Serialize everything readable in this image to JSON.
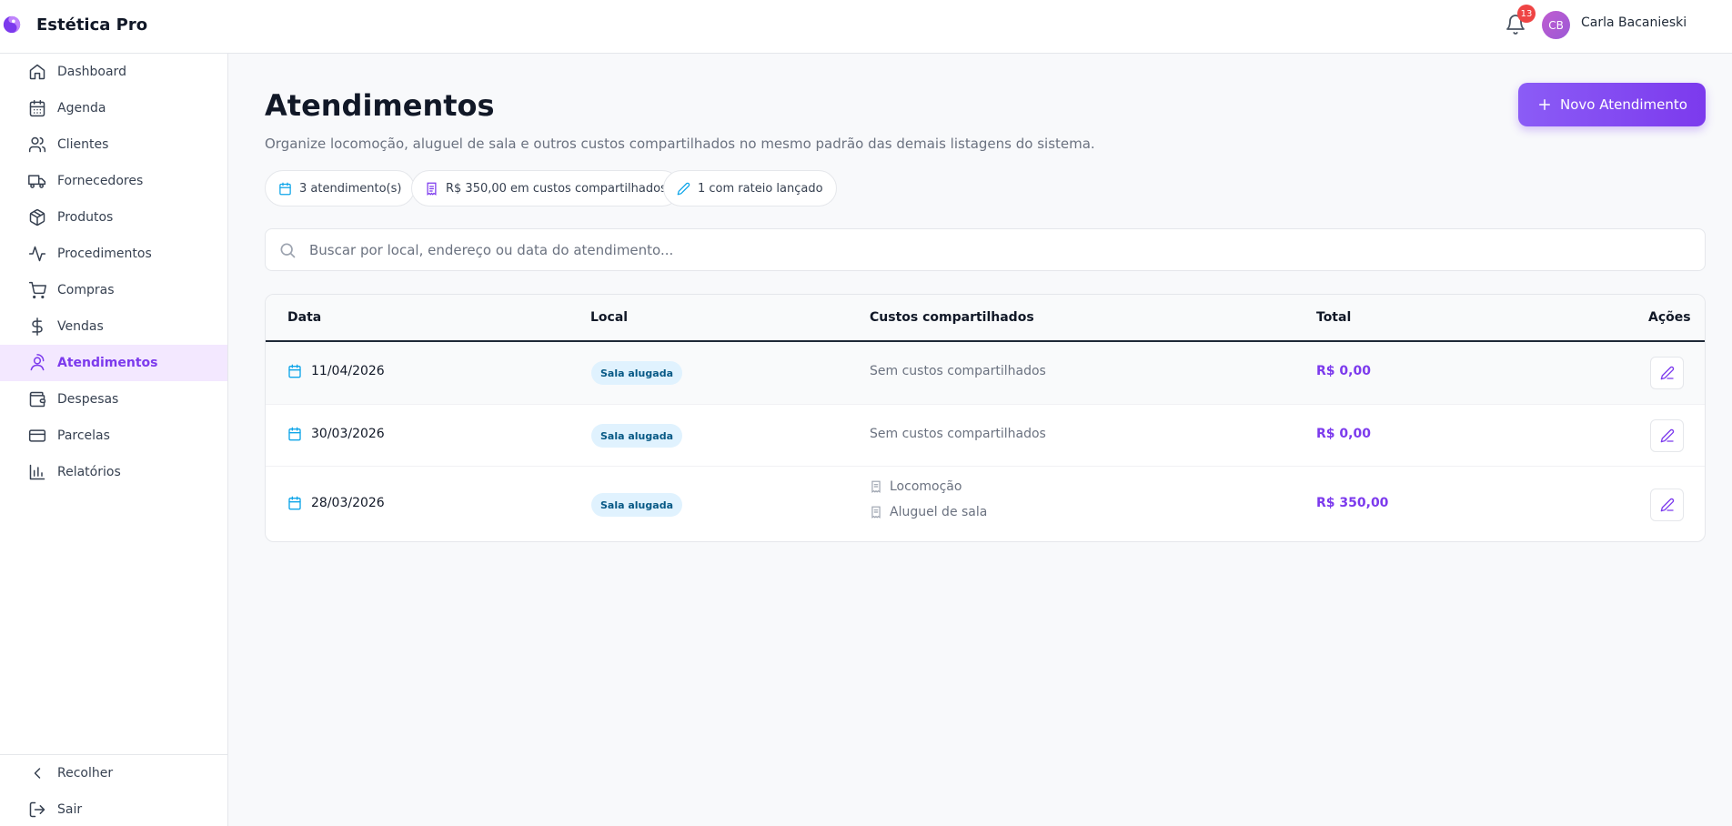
{
  "app": {
    "name": "Estética Pro"
  },
  "header": {
    "notifications_count": "13",
    "user_initials": "CB",
    "user_name": "Carla Bacanieski"
  },
  "sidebar": {
    "items": [
      {
        "label": "Dashboard",
        "icon": "home-icon"
      },
      {
        "label": "Agenda",
        "icon": "calendar-icon"
      },
      {
        "label": "Clientes",
        "icon": "users-icon"
      },
      {
        "label": "Fornecedores",
        "icon": "truck-icon"
      },
      {
        "label": "Produtos",
        "icon": "package-icon"
      },
      {
        "label": "Procedimentos",
        "icon": "activity-icon"
      },
      {
        "label": "Compras",
        "icon": "cart-icon"
      },
      {
        "label": "Vendas",
        "icon": "dollar-icon"
      },
      {
        "label": "Atendimentos",
        "icon": "user-location-icon",
        "active": true
      },
      {
        "label": "Despesas",
        "icon": "wallet-icon"
      },
      {
        "label": "Parcelas",
        "icon": "credit-card-icon"
      },
      {
        "label": "Relatórios",
        "icon": "bar-chart-icon"
      }
    ],
    "collapse_label": "Recolher",
    "logout_label": "Sair"
  },
  "page": {
    "title": "Atendimentos",
    "description": "Organize locomoção, aluguel de sala e outros custos compartilhados no mesmo padrão das demais listagens do sistema.",
    "new_button_label": "Novo Atendimento"
  },
  "chips": [
    {
      "label": "3 atendimento(s)",
      "icon": "calendar-icon"
    },
    {
      "label": "R$ 350,00 em custos compartilhados",
      "icon": "receipt-icon"
    },
    {
      "label": "1 com rateio lançado",
      "icon": "pencil-icon"
    }
  ],
  "search": {
    "placeholder": "Buscar por local, endereço ou data do atendimento..."
  },
  "table": {
    "headers": {
      "date": "Data",
      "location": "Local",
      "costs": "Custos compartilhados",
      "total": "Total",
      "actions": "Ações"
    },
    "rows": [
      {
        "date": "11/04/2026",
        "location": "Sala alugada",
        "costs_empty": "Sem custos compartilhados",
        "costs": [],
        "total": "R$ 0,00"
      },
      {
        "date": "30/03/2026",
        "location": "Sala alugada",
        "costs_empty": "Sem custos compartilhados",
        "costs": [],
        "total": "R$ 0,00"
      },
      {
        "date": "28/03/2026",
        "location": "Sala alugada",
        "costs_empty": "",
        "costs": [
          "Locomoção",
          "Aluguel de sala"
        ],
        "total": "R$ 350,00"
      }
    ]
  },
  "colors": {
    "accent": "#7c3aed",
    "info": "#0ea5e9",
    "badge": "#ef4444"
  }
}
